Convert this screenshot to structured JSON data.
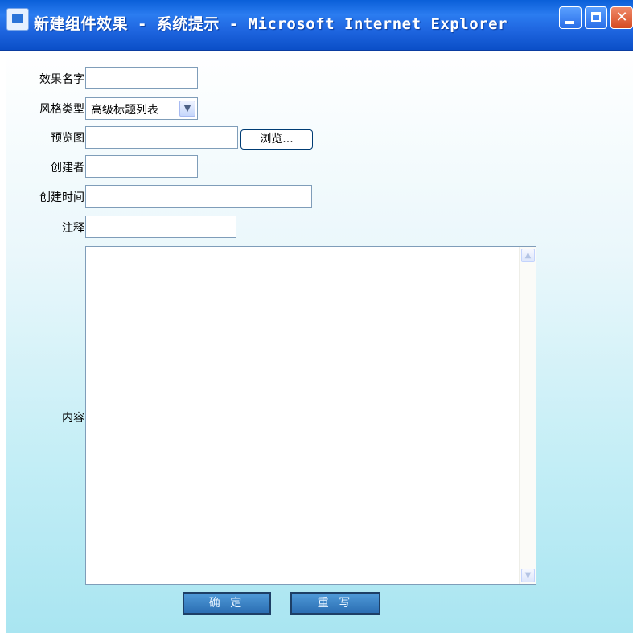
{
  "window": {
    "title": "新建组件效果 - 系统提示 - Microsoft Internet Explorer",
    "buttons": {
      "min": "minimize",
      "max": "maximize",
      "close": "✕"
    }
  },
  "form": {
    "fields": {
      "effect_name": {
        "label": "效果名字",
        "value": ""
      },
      "style_type": {
        "label": "风格类型",
        "selected": "高级标题列表"
      },
      "preview": {
        "label": "预览图",
        "value": "",
        "browse_label": "浏览..."
      },
      "creator": {
        "label": "创建者",
        "value": ""
      },
      "created_time": {
        "label": "创建时间",
        "value": ""
      },
      "note": {
        "label": "注释",
        "value": ""
      },
      "content": {
        "label": "内容",
        "value": ""
      }
    },
    "buttons": {
      "ok": "确 定",
      "reset": "重 写"
    }
  },
  "colors": {
    "titlebar": "#1f66e0",
    "button_bg": "#3b84c6",
    "client_bottom": "#a9e5f1"
  }
}
